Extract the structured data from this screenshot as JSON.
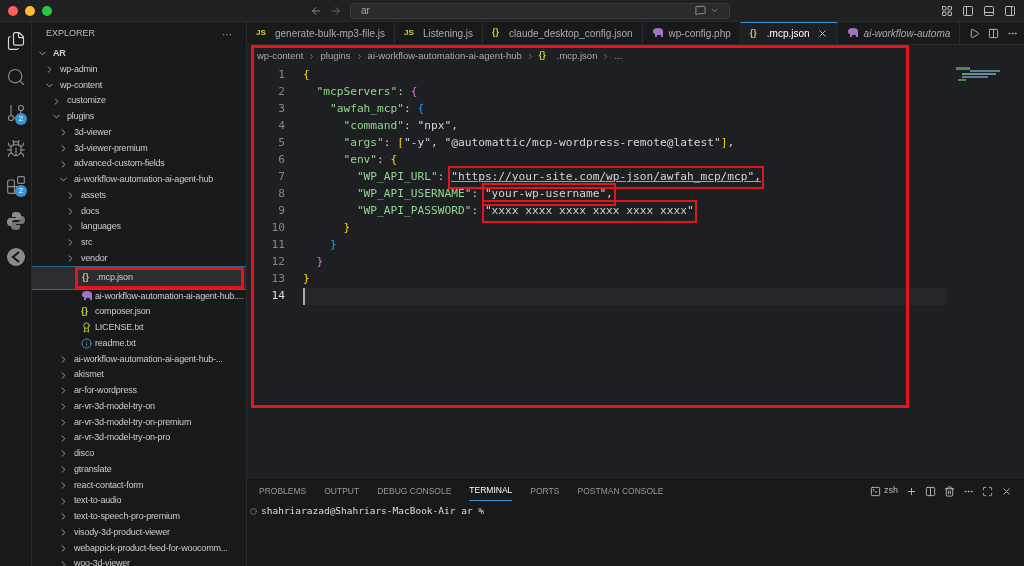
{
  "title_bar": {
    "search": {
      "value": "ar"
    }
  },
  "activity_bar": [
    {
      "kind": "files",
      "selected": true
    },
    {
      "kind": "search",
      "selected": false
    },
    {
      "kind": "source-control",
      "badge": "2",
      "selected": false
    },
    {
      "kind": "run",
      "selected": false
    },
    {
      "kind": "extensions",
      "badge": "2",
      "selected": false
    },
    {
      "kind": "python",
      "selected": false
    },
    {
      "kind": "remote",
      "selected": false
    }
  ],
  "sidebar": {
    "title": "EXPLORER",
    "more": "···",
    "tree": [
      {
        "label": "AR",
        "kind": "root",
        "expanded": true,
        "children": [
          {
            "label": "wp-admin",
            "kind": "folder",
            "expanded": false
          },
          {
            "label": "wp-content",
            "kind": "folder",
            "expanded": true,
            "children": [
              {
                "label": "customize",
                "kind": "folder",
                "expanded": false
              },
              {
                "label": "plugins",
                "kind": "folder",
                "expanded": true,
                "children": [
                  {
                    "label": "3d-viewer",
                    "kind": "folder",
                    "expanded": false
                  },
                  {
                    "label": "3d-viewer-premium",
                    "kind": "folder",
                    "expanded": false
                  },
                  {
                    "label": "advanced-custom-fields",
                    "kind": "folder",
                    "expanded": false
                  },
                  {
                    "label": "ai-workflow-automation-ai-agent-hub",
                    "kind": "folder",
                    "expanded": true,
                    "children": [
                      {
                        "label": "assets",
                        "kind": "folder",
                        "expanded": false
                      },
                      {
                        "label": "docs",
                        "kind": "folder",
                        "expanded": false
                      },
                      {
                        "label": "languages",
                        "kind": "folder",
                        "expanded": false
                      },
                      {
                        "label": "src",
                        "kind": "folder",
                        "expanded": false
                      },
                      {
                        "label": "vendor",
                        "kind": "folder",
                        "expanded": false
                      },
                      {
                        "label": ".mcp.json",
                        "kind": "json",
                        "icon_text": "{}",
                        "selected": true,
                        "highlighted": true
                      },
                      {
                        "label": "ai-workflow-automation-ai-agent-hub....",
                        "kind": "php",
                        "selected": false,
                        "highlighted": false
                      },
                      {
                        "label": "composer.json",
                        "kind": "json",
                        "icon_text": "{}",
                        "selected": false,
                        "highlighted": false
                      },
                      {
                        "label": "LICENSE.txt",
                        "kind": "license",
                        "selected": false,
                        "highlighted": false
                      },
                      {
                        "label": "readme.txt",
                        "kind": "info",
                        "selected": false,
                        "highlighted": false
                      }
                    ]
                  },
                  {
                    "label": "ai-workflow-automation-ai-agent-hub-...",
                    "kind": "folder",
                    "expanded": false
                  },
                  {
                    "label": "akismet",
                    "kind": "folder",
                    "expanded": false
                  },
                  {
                    "label": "ar-for-wordpress",
                    "kind": "folder",
                    "expanded": false
                  },
                  {
                    "label": "ar-vr-3d-model-try-on",
                    "kind": "folder",
                    "expanded": false
                  },
                  {
                    "label": "ar-vr-3d-model-try-on-premium",
                    "kind": "folder",
                    "expanded": false
                  },
                  {
                    "label": "ar-vr-3d-model-try-on-pro",
                    "kind": "folder",
                    "expanded": false
                  },
                  {
                    "label": "disco",
                    "kind": "folder",
                    "expanded": false
                  },
                  {
                    "label": "gtranslate",
                    "kind": "folder",
                    "expanded": false
                  },
                  {
                    "label": "react-contact-form",
                    "kind": "folder",
                    "expanded": false
                  },
                  {
                    "label": "text-to-audio",
                    "kind": "folder",
                    "expanded": false
                  },
                  {
                    "label": "text-to-speech-pro-premium",
                    "kind": "folder",
                    "expanded": false
                  },
                  {
                    "label": "visody-3d-product-viewer",
                    "kind": "folder",
                    "expanded": false
                  },
                  {
                    "label": "webappick-product-feed-for-woocomm...",
                    "kind": "folder",
                    "expanded": false
                  },
                  {
                    "label": "woo-3d-viewer",
                    "kind": "folder",
                    "expanded": false
                  }
                ]
              }
            ]
          }
        ]
      }
    ]
  },
  "tabs": [
    {
      "label": "generate-bulk-mp3-file.js",
      "kind": "js",
      "icon_text": "JS",
      "selected": false,
      "preview": false
    },
    {
      "label": "Listening.js",
      "kind": "js",
      "icon_text": "JS",
      "selected": false,
      "preview": false
    },
    {
      "label": "claude_desktop_config.json",
      "kind": "json",
      "icon_text": "{}",
      "selected": false,
      "preview": false
    },
    {
      "label": "wp-config.php",
      "kind": "php",
      "selected": false,
      "preview": false
    },
    {
      "label": ".mcp.json",
      "kind": "json",
      "icon_text": "{}",
      "selected": true,
      "preview": false
    },
    {
      "label": "ai-workflow-automa",
      "kind": "php",
      "selected": false,
      "preview": true
    }
  ],
  "editor": {
    "outlined": true,
    "breadcrumbs": [
      {
        "label": "wp-content"
      },
      {
        "label": "plugins"
      },
      {
        "label": "ai-workflow-automation-ai-agent-hub"
      },
      {
        "label": ".mcp.json",
        "icon_text": "{}"
      },
      {
        "label": "..."
      }
    ],
    "lines": [
      {
        "number": "1",
        "tokens": [
          {
            "text": "{",
            "kind": "brace1"
          }
        ]
      },
      {
        "number": "2",
        "tokens": [
          {
            "text": "  \"mcpServers\"",
            "kind": "key"
          },
          {
            "text": ": ",
            "kind": "punct"
          },
          {
            "text": "{",
            "kind": "brace2"
          }
        ]
      },
      {
        "number": "3",
        "tokens": [
          {
            "text": "    \"awfah_mcp\"",
            "kind": "key"
          },
          {
            "text": ": ",
            "kind": "punct"
          },
          {
            "text": "{",
            "kind": "brace3"
          }
        ]
      },
      {
        "number": "4",
        "tokens": [
          {
            "text": "      \"command\"",
            "kind": "key"
          },
          {
            "text": ": ",
            "kind": "punct"
          },
          {
            "text": "\"npx\"",
            "kind": "string"
          },
          {
            "text": ",",
            "kind": "punct"
          }
        ]
      },
      {
        "number": "5",
        "tokens": [
          {
            "text": "      \"args\"",
            "kind": "key"
          },
          {
            "text": ": ",
            "kind": "punct"
          },
          {
            "text": "[",
            "kind": "brace1"
          },
          {
            "text": "\"-y\"",
            "kind": "string"
          },
          {
            "text": ", ",
            "kind": "punct"
          },
          {
            "text": "\"@automattic/mcp-wordpress-remote@latest\"",
            "kind": "string"
          },
          {
            "text": "]",
            "kind": "brace1"
          },
          {
            "text": ",",
            "kind": "punct"
          }
        ]
      },
      {
        "number": "6",
        "tokens": [
          {
            "text": "      \"env\"",
            "kind": "key"
          },
          {
            "text": ": ",
            "kind": "punct"
          },
          {
            "text": "{",
            "kind": "brace1"
          }
        ]
      },
      {
        "number": "7",
        "tokens": [
          {
            "text": "        \"WP_API_URL\"",
            "kind": "key"
          },
          {
            "text": ": ",
            "kind": "punct"
          },
          {
            "text": "\"https://your-site.com/wp-json/awfah_mcp/mcp\",",
            "kind": "link",
            "boxed": true
          }
        ]
      },
      {
        "number": "8",
        "tokens": [
          {
            "text": "        \"WP_API_USERNAME\"",
            "kind": "key"
          },
          {
            "text": ": ",
            "kind": "punct"
          },
          {
            "text": "\"your-wp-username\",",
            "kind": "string",
            "boxed": true
          }
        ]
      },
      {
        "number": "9",
        "tokens": [
          {
            "text": "        \"WP_API_PASSWORD\"",
            "kind": "key"
          },
          {
            "text": ": ",
            "kind": "punct"
          },
          {
            "text": "\"xxxx xxxx xxxx xxxx xxxx xxxx\"",
            "kind": "string",
            "boxed": true
          }
        ]
      },
      {
        "number": "10",
        "tokens": [
          {
            "text": "      }",
            "kind": "brace1"
          }
        ]
      },
      {
        "number": "11",
        "tokens": [
          {
            "text": "    }",
            "kind": "brace3"
          }
        ]
      },
      {
        "number": "12",
        "tokens": [
          {
            "text": "  }",
            "kind": "brace2"
          }
        ]
      },
      {
        "number": "13",
        "tokens": [
          {
            "text": "}",
            "kind": "brace1"
          }
        ]
      },
      {
        "number": "14",
        "current": true
      }
    ]
  },
  "panel": {
    "tabs": [
      {
        "label": "PROBLEMS",
        "selected": false
      },
      {
        "label": "OUTPUT",
        "selected": false
      },
      {
        "label": "DEBUG CONSOLE",
        "selected": false
      },
      {
        "label": "TERMINAL",
        "selected": true
      },
      {
        "label": "PORTS",
        "selected": false
      },
      {
        "label": "POSTMAN CONSOLE",
        "selected": false
      }
    ],
    "shell": "zsh",
    "prompt": "shahriarazad@Shahriars-MacBook-Air ar %"
  }
}
